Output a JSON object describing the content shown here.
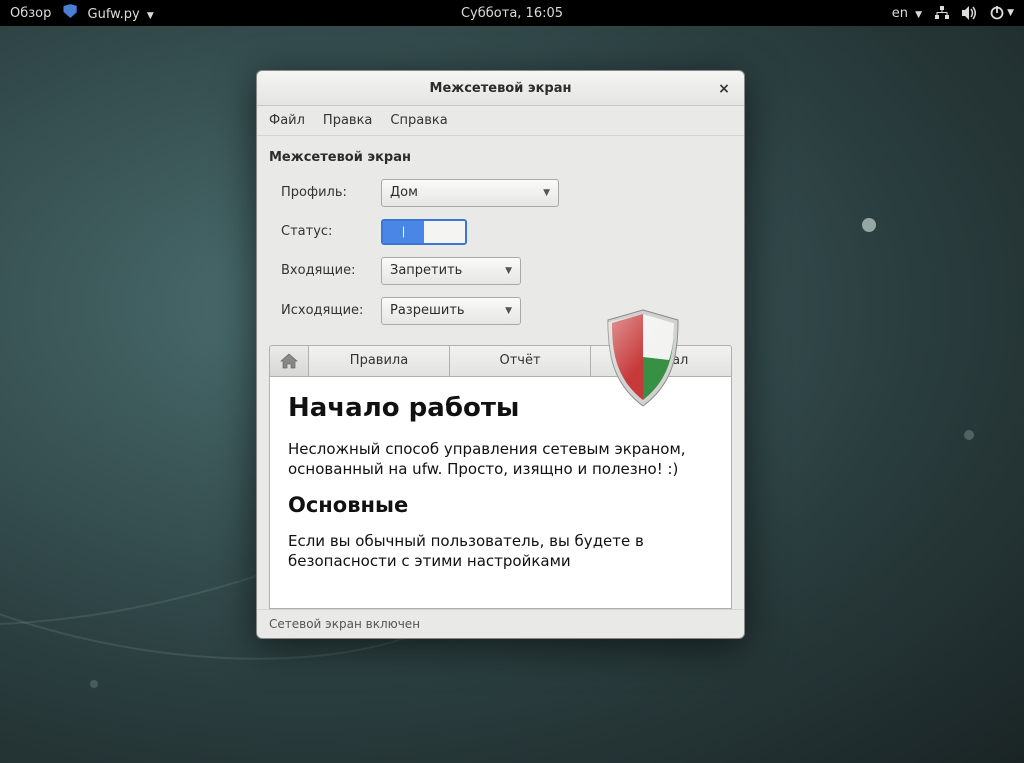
{
  "topbar": {
    "activities": "Обзор",
    "appname": "Gufw.py",
    "clock": "Суббота, 16:05",
    "lang": "en"
  },
  "window": {
    "title": "Межсетевой экран",
    "menus": {
      "file": "Файл",
      "edit": "Правка",
      "help": "Справка"
    },
    "section": "Межсетевой экран",
    "labels": {
      "profile": "Профиль:",
      "status": "Статус:",
      "incoming": "Входящие:",
      "outgoing": "Исходящие:"
    },
    "values": {
      "profile": "Дом",
      "incoming": "Запретить",
      "outgoing": "Разрешить"
    },
    "tabs": {
      "rules": "Правила",
      "report": "Отчёт",
      "log": "Журнал"
    },
    "content": {
      "h1": "Начало работы",
      "p1": "Несложный способ управления сетевым экраном, основанный на ufw. Просто, изящно и полезно! :)",
      "h2": "Основные",
      "p2": "Если вы обычный пользователь, вы будете в безопасности с этими настройками"
    },
    "status": "Сетевой экран включен"
  }
}
